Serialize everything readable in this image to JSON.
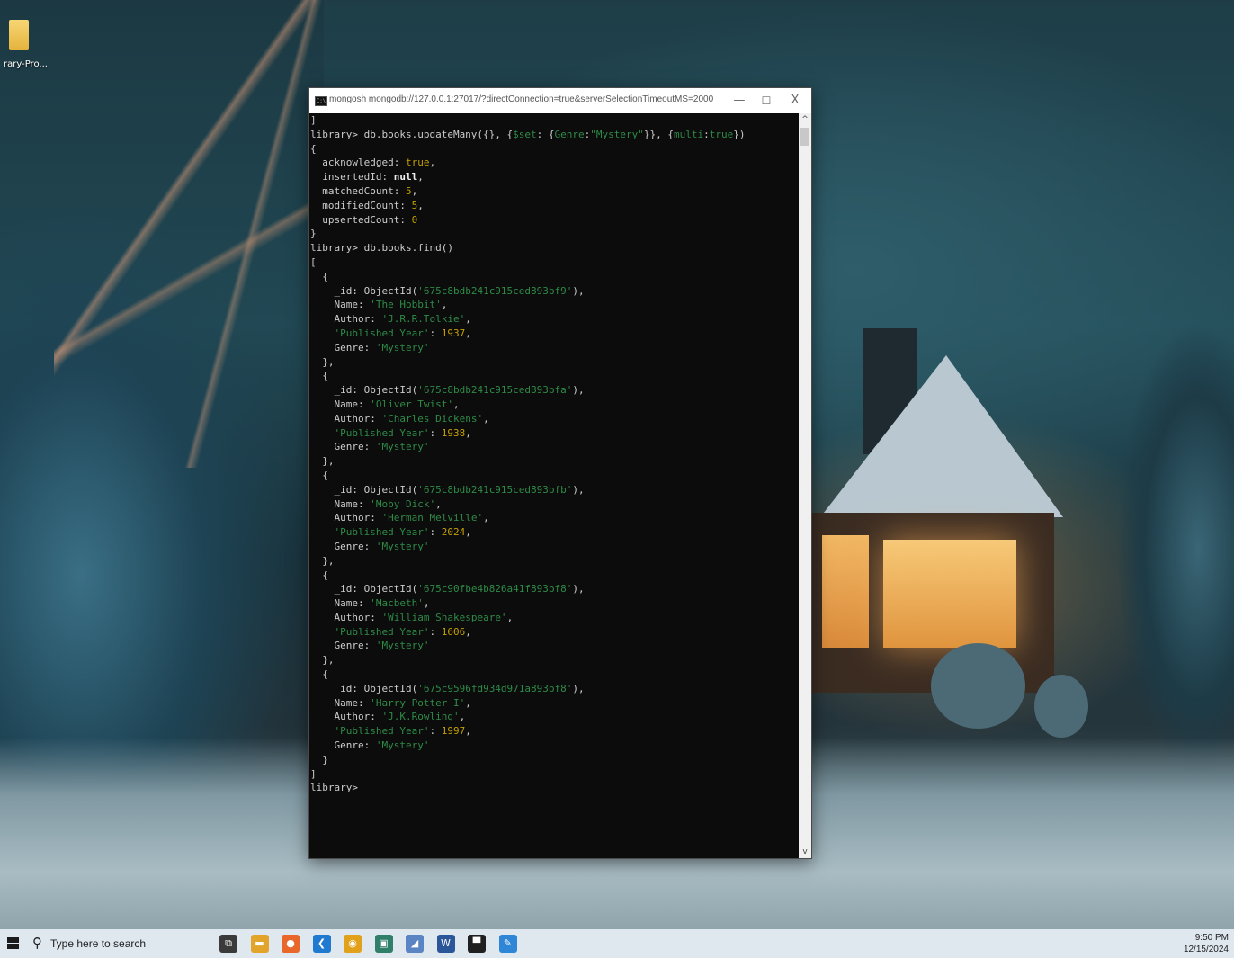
{
  "desktop": {
    "icon_label": "rary-Pro..."
  },
  "window": {
    "title": "mongosh mongodb://127.0.0.1:27017/?directConnection=true&serverSelectionTimeoutMS=2000",
    "app_icon_text": "C:\\",
    "minimize_glyph": "—",
    "maximize_glyph": "☐",
    "close_glyph": "X"
  },
  "console": {
    "lines": [
      [
        {
          "t": "]",
          "c": ""
        }
      ],
      [
        {
          "t": "library> db.books.updateMany({}, {",
          "c": ""
        },
        {
          "t": "$set",
          "c": "g"
        },
        {
          "t": ": {",
          "c": ""
        },
        {
          "t": "Genre",
          "c": "g"
        },
        {
          "t": ":",
          "c": ""
        },
        {
          "t": "\"Mystery\"",
          "c": "g"
        },
        {
          "t": "}}, {",
          "c": ""
        },
        {
          "t": "multi",
          "c": "g"
        },
        {
          "t": ":",
          "c": ""
        },
        {
          "t": "true",
          "c": "g"
        },
        {
          "t": "})",
          "c": ""
        }
      ],
      [
        {
          "t": "{",
          "c": ""
        }
      ],
      [
        {
          "t": "  acknowledged: ",
          "c": ""
        },
        {
          "t": "true",
          "c": "y"
        },
        {
          "t": ",",
          "c": ""
        }
      ],
      [
        {
          "t": "  insertedId: ",
          "c": ""
        },
        {
          "t": "null",
          "c": "w"
        },
        {
          "t": ",",
          "c": ""
        }
      ],
      [
        {
          "t": "  matchedCount: ",
          "c": ""
        },
        {
          "t": "5",
          "c": "y"
        },
        {
          "t": ",",
          "c": ""
        }
      ],
      [
        {
          "t": "  modifiedCount: ",
          "c": ""
        },
        {
          "t": "5",
          "c": "y"
        },
        {
          "t": ",",
          "c": ""
        }
      ],
      [
        {
          "t": "  upsertedCount: ",
          "c": ""
        },
        {
          "t": "0",
          "c": "y"
        }
      ],
      [
        {
          "t": "}",
          "c": ""
        }
      ],
      [
        {
          "t": "library> db.books.find()",
          "c": ""
        }
      ],
      [
        {
          "t": "[",
          "c": ""
        }
      ],
      [
        {
          "t": "  {",
          "c": ""
        }
      ],
      [
        {
          "t": "    _id: ObjectId(",
          "c": ""
        },
        {
          "t": "'675c8bdb241c915ced893bf9'",
          "c": "g"
        },
        {
          "t": "),",
          "c": ""
        }
      ],
      [
        {
          "t": "    Name: ",
          "c": ""
        },
        {
          "t": "'The Hobbit'",
          "c": "g"
        },
        {
          "t": ",",
          "c": ""
        }
      ],
      [
        {
          "t": "    Author: ",
          "c": ""
        },
        {
          "t": "'J.R.R.Tolkie'",
          "c": "g"
        },
        {
          "t": ",",
          "c": ""
        }
      ],
      [
        {
          "t": "    ",
          "c": ""
        },
        {
          "t": "'Published Year'",
          "c": "g"
        },
        {
          "t": ": ",
          "c": ""
        },
        {
          "t": "1937",
          "c": "y"
        },
        {
          "t": ",",
          "c": ""
        }
      ],
      [
        {
          "t": "    Genre: ",
          "c": ""
        },
        {
          "t": "'Mystery'",
          "c": "g"
        }
      ],
      [
        {
          "t": "  },",
          "c": ""
        }
      ],
      [
        {
          "t": "  {",
          "c": ""
        }
      ],
      [
        {
          "t": "    _id: ObjectId(",
          "c": ""
        },
        {
          "t": "'675c8bdb241c915ced893bfa'",
          "c": "g"
        },
        {
          "t": "),",
          "c": ""
        }
      ],
      [
        {
          "t": "    Name: ",
          "c": ""
        },
        {
          "t": "'Oliver Twist'",
          "c": "g"
        },
        {
          "t": ",",
          "c": ""
        }
      ],
      [
        {
          "t": "    Author: ",
          "c": ""
        },
        {
          "t": "'Charles Dickens'",
          "c": "g"
        },
        {
          "t": ",",
          "c": ""
        }
      ],
      [
        {
          "t": "    ",
          "c": ""
        },
        {
          "t": "'Published Year'",
          "c": "g"
        },
        {
          "t": ": ",
          "c": ""
        },
        {
          "t": "1938",
          "c": "y"
        },
        {
          "t": ",",
          "c": ""
        }
      ],
      [
        {
          "t": "    Genre: ",
          "c": ""
        },
        {
          "t": "'Mystery'",
          "c": "g"
        }
      ],
      [
        {
          "t": "  },",
          "c": ""
        }
      ],
      [
        {
          "t": "  {",
          "c": ""
        }
      ],
      [
        {
          "t": "    _id: ObjectId(",
          "c": ""
        },
        {
          "t": "'675c8bdb241c915ced893bfb'",
          "c": "g"
        },
        {
          "t": "),",
          "c": ""
        }
      ],
      [
        {
          "t": "    Name: ",
          "c": ""
        },
        {
          "t": "'Moby Dick'",
          "c": "g"
        },
        {
          "t": ",",
          "c": ""
        }
      ],
      [
        {
          "t": "    Author: ",
          "c": ""
        },
        {
          "t": "'Herman Melville'",
          "c": "g"
        },
        {
          "t": ",",
          "c": ""
        }
      ],
      [
        {
          "t": "    ",
          "c": ""
        },
        {
          "t": "'Published Year'",
          "c": "g"
        },
        {
          "t": ": ",
          "c": ""
        },
        {
          "t": "2024",
          "c": "y"
        },
        {
          "t": ",",
          "c": ""
        }
      ],
      [
        {
          "t": "    Genre: ",
          "c": ""
        },
        {
          "t": "'Mystery'",
          "c": "g"
        }
      ],
      [
        {
          "t": "  },",
          "c": ""
        }
      ],
      [
        {
          "t": "  {",
          "c": ""
        }
      ],
      [
        {
          "t": "    _id: ObjectId(",
          "c": ""
        },
        {
          "t": "'675c90fbe4b826a41f893bf8'",
          "c": "g"
        },
        {
          "t": "),",
          "c": ""
        }
      ],
      [
        {
          "t": "    Name: ",
          "c": ""
        },
        {
          "t": "'Macbeth'",
          "c": "g"
        },
        {
          "t": ",",
          "c": ""
        }
      ],
      [
        {
          "t": "    Author: ",
          "c": ""
        },
        {
          "t": "'William Shakespeare'",
          "c": "g"
        },
        {
          "t": ",",
          "c": ""
        }
      ],
      [
        {
          "t": "    ",
          "c": ""
        },
        {
          "t": "'Published Year'",
          "c": "g"
        },
        {
          "t": ": ",
          "c": ""
        },
        {
          "t": "1606",
          "c": "y"
        },
        {
          "t": ",",
          "c": ""
        }
      ],
      [
        {
          "t": "    Genre: ",
          "c": ""
        },
        {
          "t": "'Mystery'",
          "c": "g"
        }
      ],
      [
        {
          "t": "  },",
          "c": ""
        }
      ],
      [
        {
          "t": "  {",
          "c": ""
        }
      ],
      [
        {
          "t": "    _id: ObjectId(",
          "c": ""
        },
        {
          "t": "'675c9596fd934d971a893bf8'",
          "c": "g"
        },
        {
          "t": "),",
          "c": ""
        }
      ],
      [
        {
          "t": "    Name: ",
          "c": ""
        },
        {
          "t": "'Harry Potter I'",
          "c": "g"
        },
        {
          "t": ",",
          "c": ""
        }
      ],
      [
        {
          "t": "    Author: ",
          "c": ""
        },
        {
          "t": "'J.K.Rowling'",
          "c": "g"
        },
        {
          "t": ",",
          "c": ""
        }
      ],
      [
        {
          "t": "    ",
          "c": ""
        },
        {
          "t": "'Published Year'",
          "c": "g"
        },
        {
          "t": ": ",
          "c": ""
        },
        {
          "t": "1997",
          "c": "y"
        },
        {
          "t": ",",
          "c": ""
        }
      ],
      [
        {
          "t": "    Genre: ",
          "c": ""
        },
        {
          "t": "'Mystery'",
          "c": "g"
        }
      ],
      [
        {
          "t": "  }",
          "c": ""
        }
      ],
      [
        {
          "t": "]",
          "c": ""
        }
      ],
      [
        {
          "t": "library>",
          "c": ""
        }
      ]
    ]
  },
  "scrollbar": {
    "up_glyph": "^",
    "down_glyph": "v"
  },
  "taskbar": {
    "search_placeholder": "Type here to search",
    "search_glyph": "⚲",
    "apps": [
      {
        "name": "task-view-icon",
        "glyph": "⧉",
        "color": "#3a3a3a"
      },
      {
        "name": "file-explorer-icon",
        "glyph": "▬",
        "color": "#e2a42b"
      },
      {
        "name": "firefox-icon",
        "glyph": "●",
        "color": "#e8672a"
      },
      {
        "name": "vscode-icon",
        "glyph": "❮",
        "color": "#1f7ad0"
      },
      {
        "name": "chrome-icon",
        "glyph": "◉",
        "color": "#e1a11b"
      },
      {
        "name": "monitor-app-icon",
        "glyph": "▣",
        "color": "#2f7f6a"
      },
      {
        "name": "tools-app-icon",
        "glyph": "◢",
        "color": "#5a84c4"
      },
      {
        "name": "word-icon",
        "glyph": "W",
        "color": "#2b579a"
      },
      {
        "name": "terminal-icon",
        "glyph": "▀",
        "color": "#202020"
      },
      {
        "name": "pen-app-icon",
        "glyph": "✎",
        "color": "#2f86d6"
      }
    ],
    "time": "9:50 PM",
    "date": "12/15/2024"
  }
}
